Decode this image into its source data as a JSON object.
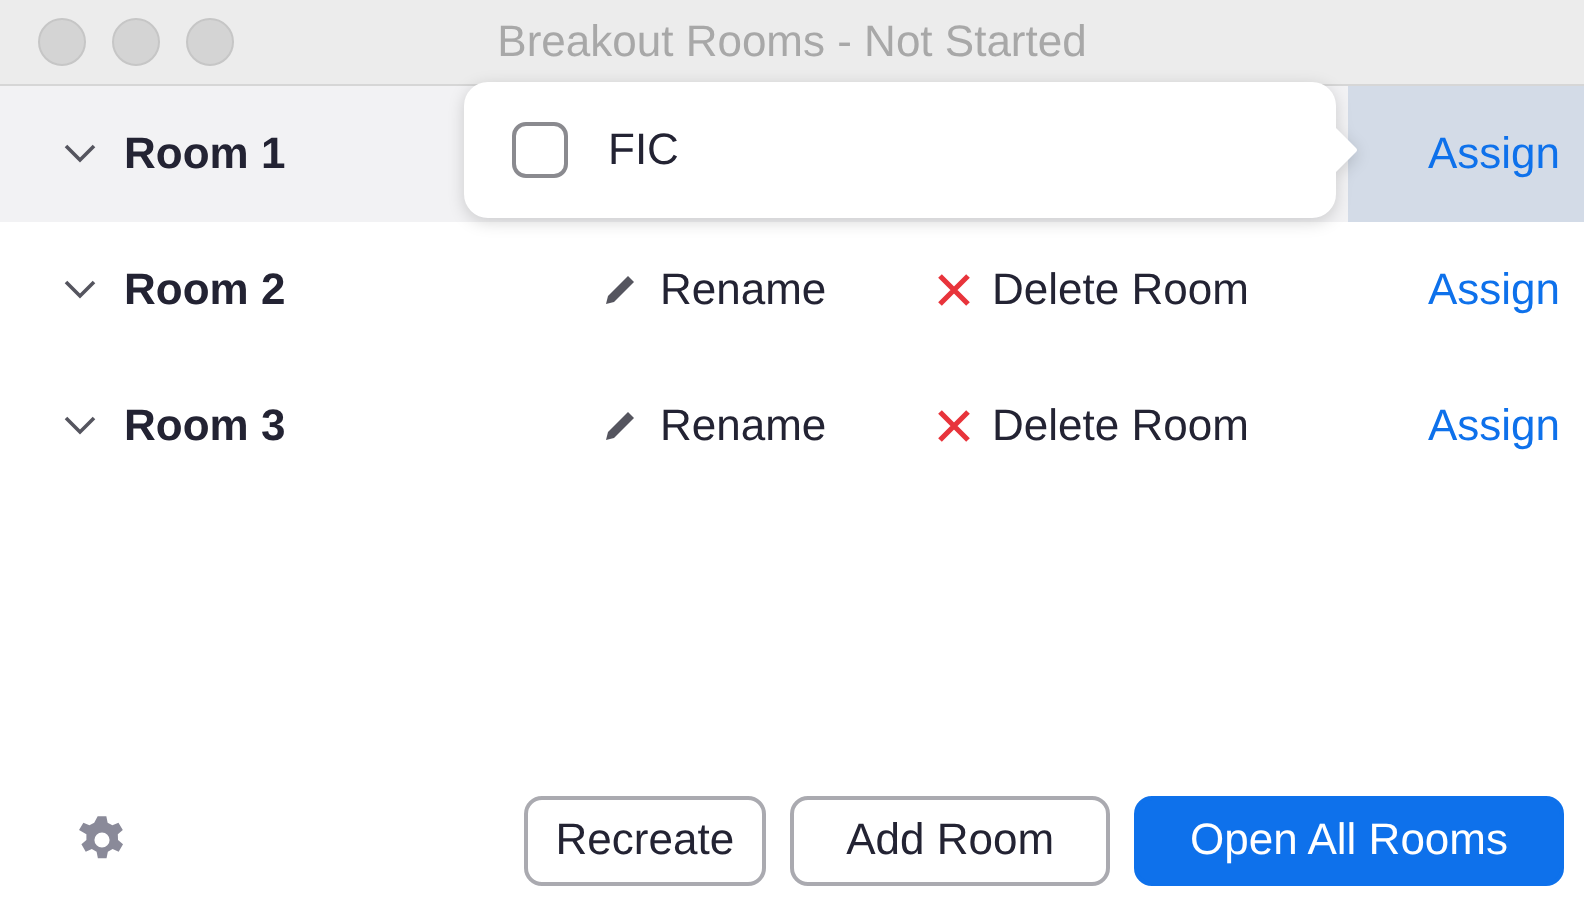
{
  "window": {
    "title": "Breakout Rooms - Not Started"
  },
  "rooms": [
    {
      "name": "Room 1",
      "selected": true,
      "assign": "Assign"
    },
    {
      "name": "Room 2",
      "selected": false,
      "rename": "Rename",
      "delete": "Delete Room",
      "assign": "Assign"
    },
    {
      "name": "Room 3",
      "selected": false,
      "rename": "Rename",
      "delete": "Delete Room",
      "assign": "Assign"
    }
  ],
  "popover": {
    "items": [
      {
        "label": "FIC",
        "checked": false
      }
    ]
  },
  "buttons": [
    {
      "label": "Recreate",
      "kind": "secondary"
    },
    {
      "label": "Add Room",
      "kind": "secondary"
    },
    {
      "label": "Open All Rooms",
      "kind": "primary"
    }
  ]
}
